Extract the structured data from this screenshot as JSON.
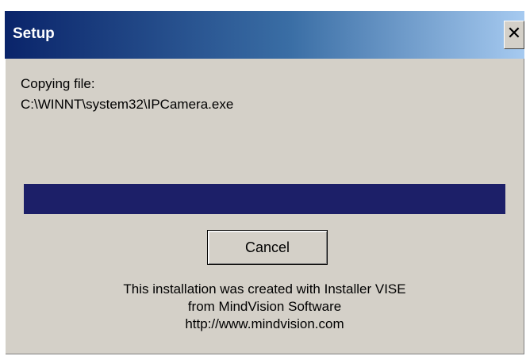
{
  "window": {
    "title": "Setup",
    "close_glyph": "✕"
  },
  "status": {
    "label": "Copying file:",
    "path": "C:\\WINNT\\system32\\IPCamera.exe"
  },
  "progress": {
    "fraction": 1.0,
    "fill_color": "#1c1f68"
  },
  "buttons": {
    "cancel_label": "Cancel"
  },
  "footer": {
    "line1": "This installation was created with Installer VISE",
    "line2": "from MindVision Software",
    "line3": "http://www.mindvision.com"
  },
  "colors": {
    "titlebar_start": "#0a246a",
    "titlebar_end": "#a6caf0",
    "dialog_bg": "#d4d0c8"
  },
  "icons": {
    "close": "close-icon"
  }
}
